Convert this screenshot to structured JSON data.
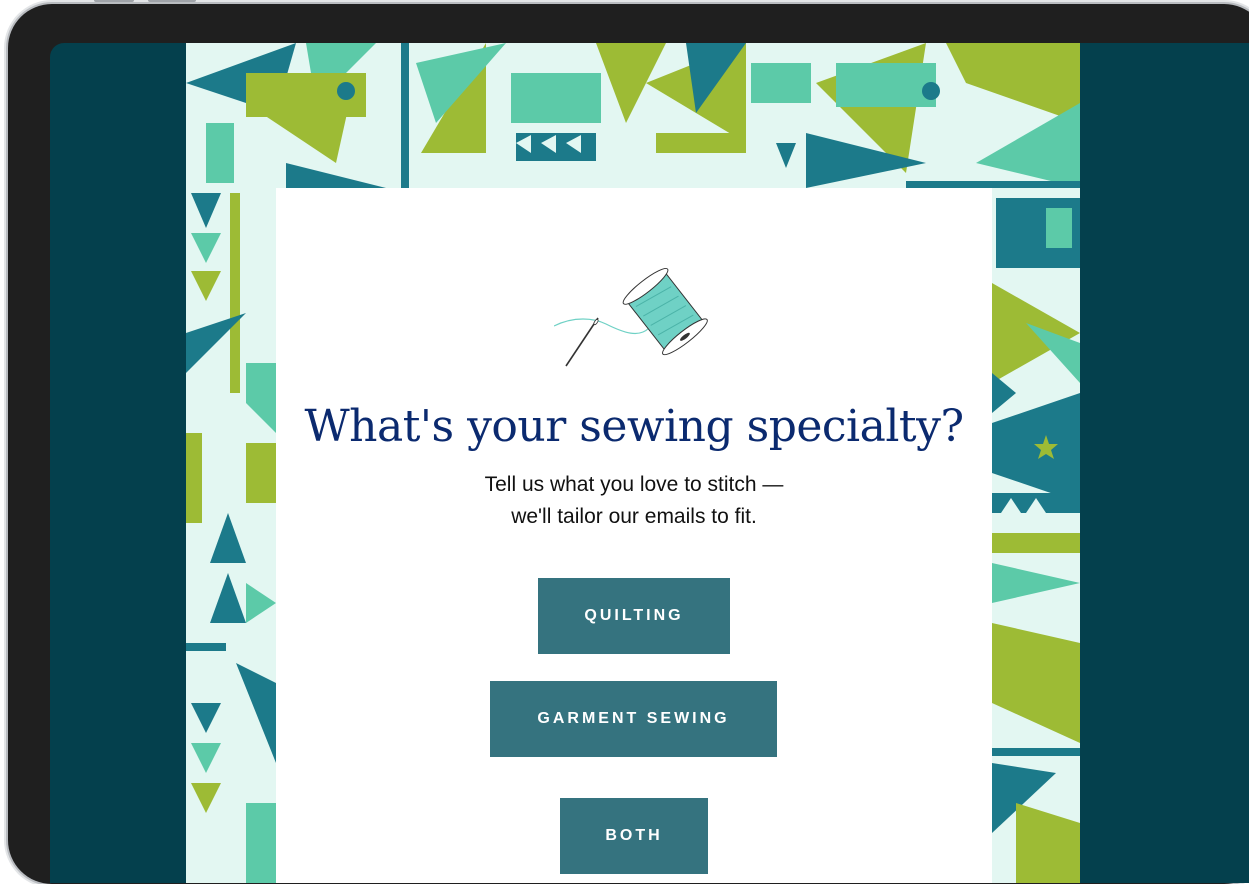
{
  "email": {
    "headline": "What's your sewing specialty?",
    "subtext_line1": "Tell us what you love to stitch —",
    "subtext_line2": "we'll tailor our emails to fit.",
    "options": [
      {
        "label": "QUILTING"
      },
      {
        "label": "GARMENT SEWING"
      },
      {
        "label": "BOTH"
      }
    ]
  },
  "colors": {
    "screen_background": "#04404d",
    "headline": "#0b2a6f",
    "button": "#35737f",
    "pattern_teal": "#1c7a8a",
    "pattern_mint": "#5ccaa8",
    "pattern_lime": "#9dbb35"
  },
  "icons": [
    "thread-spool-icon",
    "needle-icon",
    "star-icon"
  ]
}
